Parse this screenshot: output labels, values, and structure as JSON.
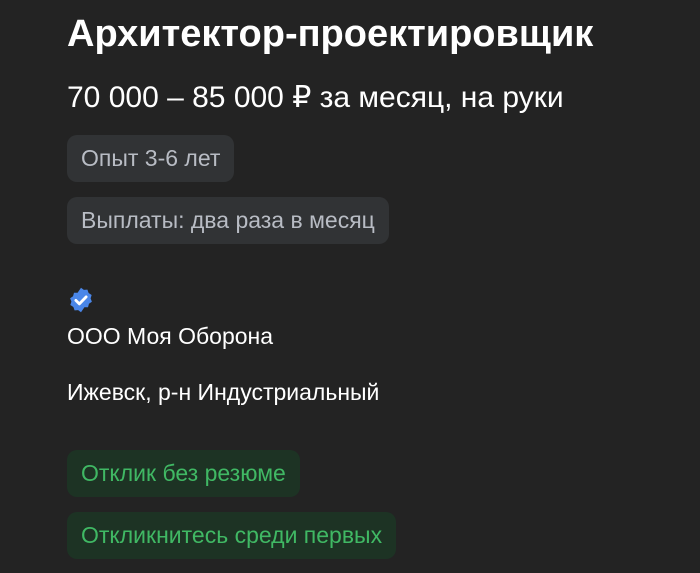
{
  "vacancy": {
    "title": "Архитектор-проектировщик",
    "salary": "70 000 – 85 000 ₽ за месяц, на руки",
    "experience": "Опыт 3-6 лет",
    "payments": "Выплаты: два раза в месяц"
  },
  "employer": {
    "verified_icon": "verified-badge-icon",
    "name": "ООО Моя Оборона",
    "location": "Ижевск, р-н Индустриальный"
  },
  "badges": {
    "no_resume": "Отклик без резюме",
    "respond_first": "Откликнитесь среди первых"
  },
  "colors": {
    "background": "#232323",
    "chip_background": "#313335",
    "chip_text": "#b8bcc4",
    "green_chip_background": "#1d3324",
    "green_text": "#40b864",
    "verified_badge": "#4a86e8"
  }
}
